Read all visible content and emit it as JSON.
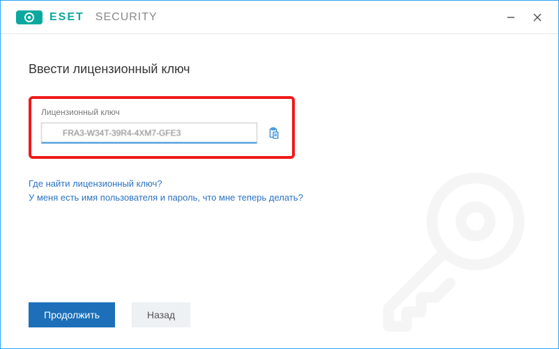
{
  "brand": {
    "eset": "ESET",
    "security": "SECURITY"
  },
  "heading": "Ввести лицензионный ключ",
  "license": {
    "label": "Лицензионный ключ",
    "value": "FRA3-W34T-39R4-4XM7-GFE3"
  },
  "links": {
    "where": "Где найти лицензионный ключ?",
    "have_credentials": "У меня есть имя пользователя и пароль, что мне теперь делать?"
  },
  "buttons": {
    "continue": "Продолжить",
    "back": "Назад"
  }
}
